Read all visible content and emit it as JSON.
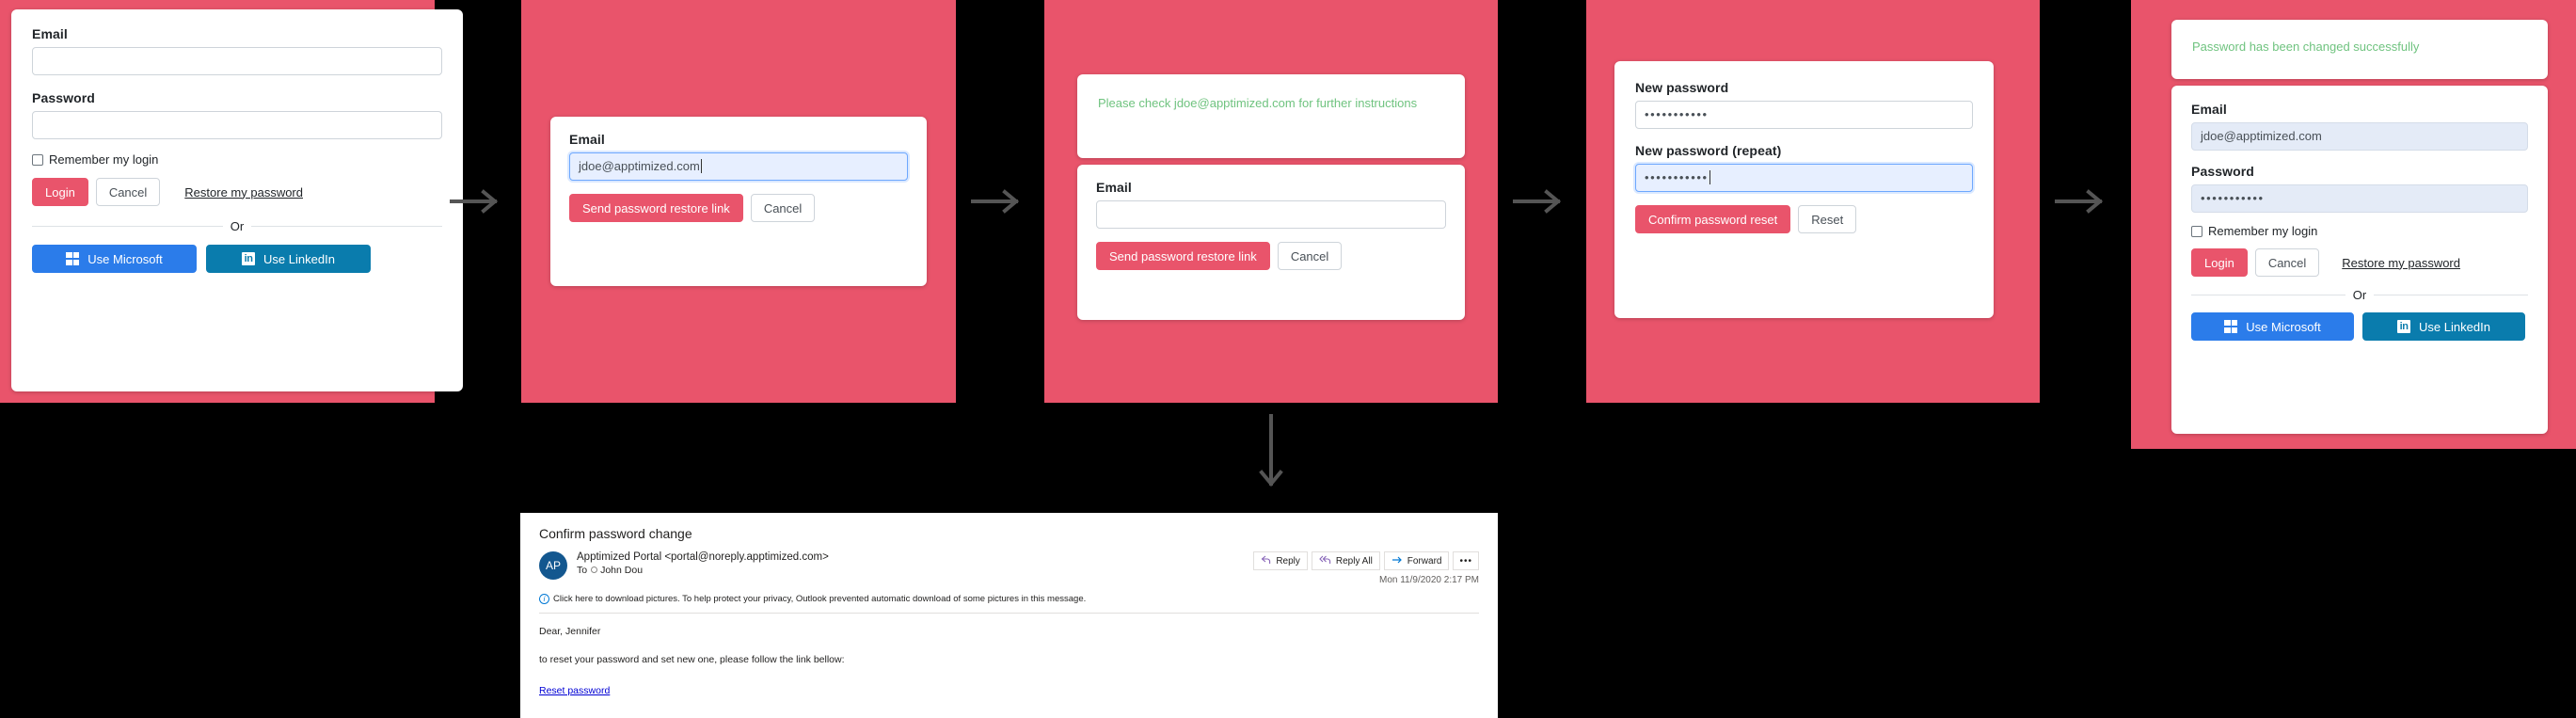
{
  "theme": {
    "panel_bg": "#e9546b",
    "page_bg": "#000000",
    "accent_pink": "#e9546b",
    "microsoft_blue": "#2b7cea",
    "linkedin_blue": "#0a7cad",
    "success_green": "#6fc37f",
    "link_blue": "#0000d4",
    "arrow_gray": "#555555"
  },
  "step1_login": {
    "email_label": "Email",
    "email_value": "",
    "password_label": "Password",
    "password_value": "",
    "remember_label": "Remember my login",
    "login_label": "Login",
    "cancel_label": "Cancel",
    "restore_label": "Restore my password",
    "or_label": "Or",
    "microsoft_label": "Use Microsoft",
    "linkedin_label": "Use LinkedIn"
  },
  "step2_restore": {
    "email_label": "Email",
    "email_value": "jdoe@apptimized.com",
    "send_label": "Send password restore link",
    "cancel_label": "Cancel"
  },
  "step3_sent": {
    "notice": "Please check jdoe@apptimized.com for further instructions",
    "email_label": "Email",
    "email_value": "",
    "send_label": "Send password restore link",
    "cancel_label": "Cancel"
  },
  "step4_newpass": {
    "new_label": "New password",
    "new_value": "•••••••••••",
    "repeat_label": "New password (repeat)",
    "repeat_value": "•••••••••••",
    "confirm_label": "Confirm password reset",
    "reset_label": "Reset"
  },
  "step5_changed": {
    "notice": "Password has been changed successfully",
    "email_label": "Email",
    "email_value": "jdoe@apptimized.com",
    "password_label": "Password",
    "password_value": "•••••••••••",
    "remember_label": "Remember my login",
    "login_label": "Login",
    "cancel_label": "Cancel",
    "restore_label": "Restore my password",
    "or_label": "Or",
    "microsoft_label": "Use Microsoft",
    "linkedin_label": "Use LinkedIn"
  },
  "email_message": {
    "subject": "Confirm password change",
    "avatar_initials": "AP",
    "from": "Apptimized Portal <portal@noreply.apptimized.com>",
    "to_prefix": "To",
    "to_name": "John Dou",
    "info_bar": "Click here to download pictures. To help protect your privacy, Outlook prevented automatic download of some pictures in this message.",
    "reply_label": "Reply",
    "reply_all_label": "Reply All",
    "forward_label": "Forward",
    "more_label": "•••",
    "date": "Mon 11/9/2020 2:17 PM",
    "greeting": "Dear, Jennifer",
    "body_line": "to reset your password and set new one, please follow the link bellow:",
    "link_label": "Reset password"
  }
}
